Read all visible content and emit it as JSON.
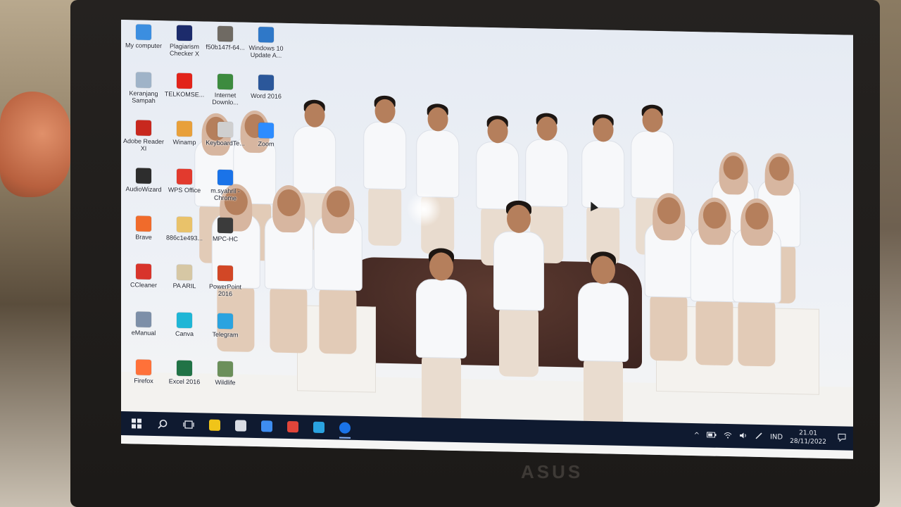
{
  "desktop": {
    "icons": [
      {
        "label": "My computer",
        "icon": "computer-icon",
        "color": "#3b8ee0"
      },
      {
        "label": "Keranjang Sampah",
        "icon": "recycle-bin-icon",
        "color": "#9fb3c8"
      },
      {
        "label": "Adobe Reader XI",
        "icon": "adobe-reader-icon",
        "color": "#c8281e"
      },
      {
        "label": "AudioWizard",
        "icon": "audiowizard-icon",
        "color": "#2d2d2d"
      },
      {
        "label": "Brave",
        "icon": "brave-icon",
        "color": "#f06b2b"
      },
      {
        "label": "CCleaner",
        "icon": "ccleaner-icon",
        "color": "#d8342b"
      },
      {
        "label": "eManual",
        "icon": "emanual-icon",
        "color": "#7d8fa8"
      },
      {
        "label": "Firefox",
        "icon": "firefox-icon",
        "color": "#ff7139"
      },
      {
        "label": "Plagiarism Checker X",
        "icon": "plagiarism-checker-icon",
        "color": "#1c2b6b"
      },
      {
        "label": "TELKOMSE...",
        "icon": "telkomsel-icon",
        "color": "#e2231a"
      },
      {
        "label": "Winamp",
        "icon": "winamp-icon",
        "color": "#e8a03a"
      },
      {
        "label": "WPS Office",
        "icon": "wps-office-icon",
        "color": "#e23a2e"
      },
      {
        "label": "886c1e493...",
        "icon": "file-icon",
        "color": "#e9c26a"
      },
      {
        "label": "PA ARIL",
        "icon": "folder-icon",
        "color": "#d6c7a4"
      },
      {
        "label": "Canva",
        "icon": "canva-icon",
        "color": "#1fb6d6"
      },
      {
        "label": "Excel 2016",
        "icon": "excel-icon",
        "color": "#217346"
      },
      {
        "label": "f50b147f-64...",
        "icon": "image-file-icon",
        "color": "#6f6a63"
      },
      {
        "label": "Internet Downlo...",
        "icon": "internet-download-manager-icon",
        "color": "#3d8b3f"
      },
      {
        "label": "KeyboardTe...",
        "icon": "keyboard-test-icon",
        "color": "#cfcfcf"
      },
      {
        "label": "m.syahril - Chrome",
        "icon": "chrome-icon",
        "color": "#1a73e8"
      },
      {
        "label": "MPC-HC",
        "icon": "mpc-hc-icon",
        "color": "#3b3b3b"
      },
      {
        "label": "PowerPoint 2016",
        "icon": "powerpoint-icon",
        "color": "#d24726"
      },
      {
        "label": "Telegram",
        "icon": "telegram-icon",
        "color": "#2aa3e0"
      },
      {
        "label": "Wildlife",
        "icon": "video-file-icon",
        "color": "#6b8f5a"
      },
      {
        "label": "Windows 10 Update A...",
        "icon": "windows-update-icon",
        "color": "#2f78c8"
      },
      {
        "label": "Word 2016",
        "icon": "word-icon",
        "color": "#2b579a"
      },
      {
        "label": "Zoom",
        "icon": "zoom-icon",
        "color": "#2d8cff"
      }
    ]
  },
  "taskbar": {
    "start": {
      "icon": "windows-start-icon"
    },
    "search": {
      "icon": "search-icon"
    },
    "taskview": {
      "icon": "task-view-icon"
    },
    "apps": [
      {
        "name": "file-explorer",
        "icon": "folder-icon",
        "color": "#f0c419",
        "active": false
      },
      {
        "name": "media-player",
        "icon": "media-player-icon",
        "color": "#d9dde5",
        "active": false
      },
      {
        "name": "slash-app",
        "icon": "slash-icon",
        "color": "#3e8df0",
        "active": false
      },
      {
        "name": "presentation-app",
        "icon": "presentation-icon",
        "color": "#e0453a",
        "active": false
      },
      {
        "name": "telegram",
        "icon": "telegram-icon",
        "color": "#2aa3e0",
        "active": false
      },
      {
        "name": "chrome",
        "icon": "chrome-icon",
        "color": "#1a73e8",
        "active": true
      }
    ],
    "tray": {
      "chevron": "^",
      "language": "IND",
      "time": "21.01",
      "date": "28/11/2022"
    }
  },
  "hardware": {
    "brand": "ASUS"
  }
}
